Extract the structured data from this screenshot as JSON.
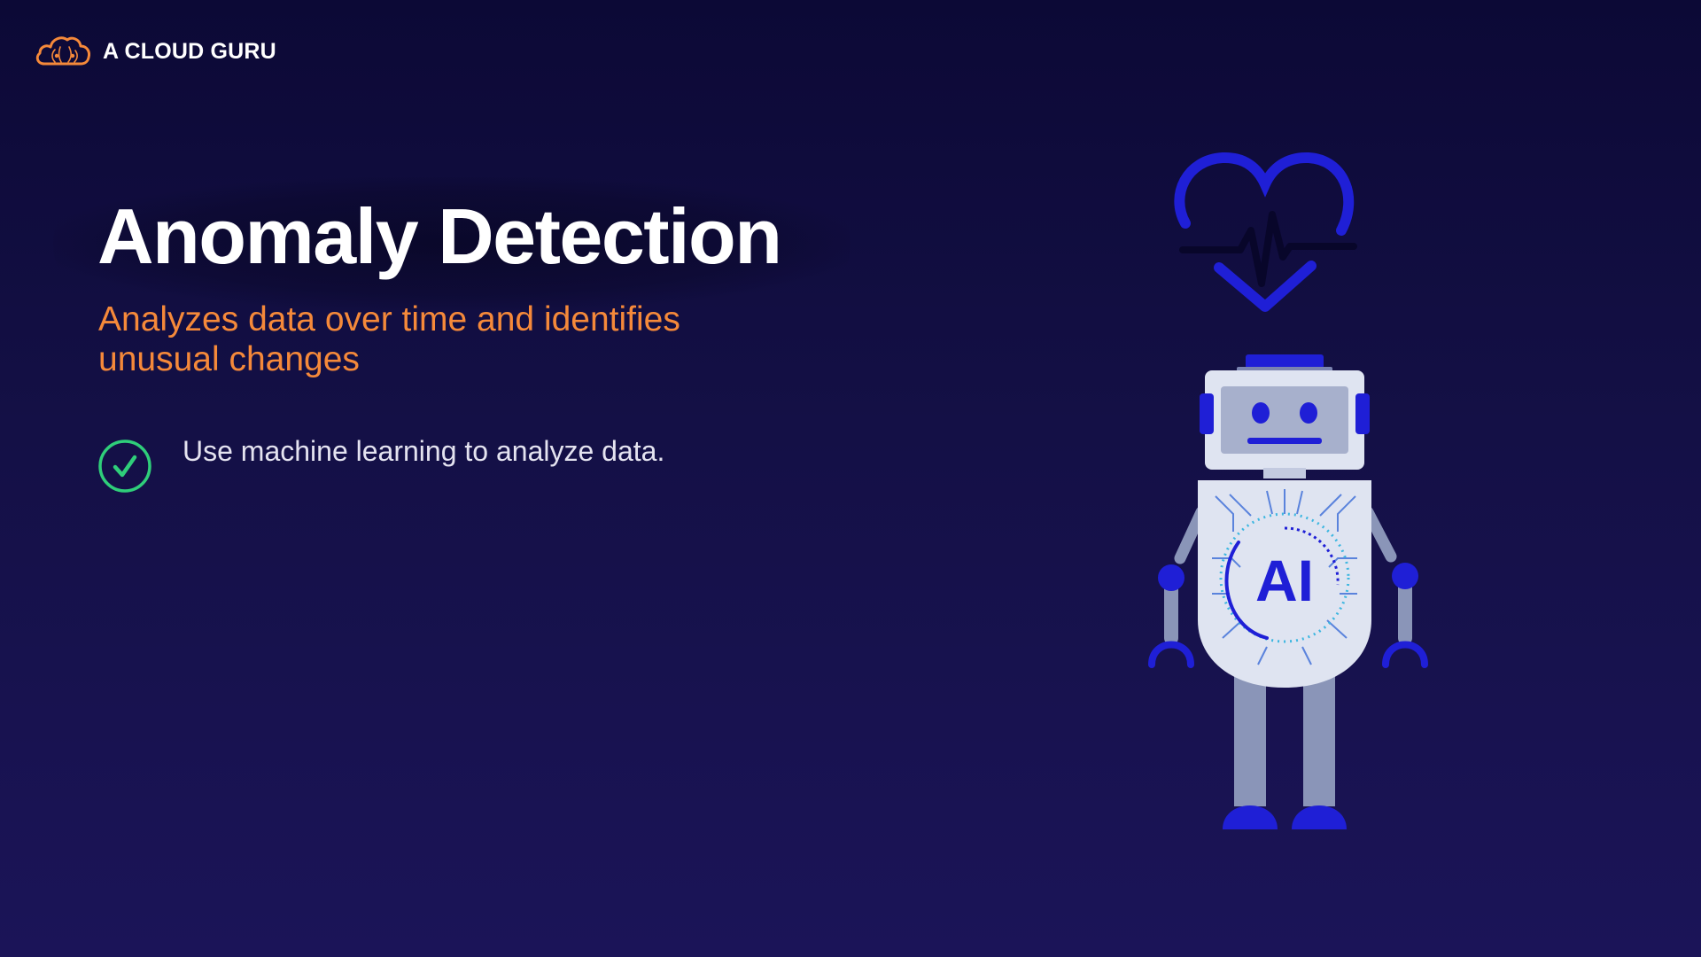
{
  "brand": {
    "name": "A CLOUD GURU",
    "icon": "cloud-logo-icon",
    "accent_color": "#f5893a"
  },
  "slide": {
    "title": "Anomaly Detection",
    "subtitle": "Analyzes data over time and identifies unusual changes",
    "bullets": [
      {
        "icon": "check-circle-icon",
        "text": "Use machine learning to analyze data."
      }
    ]
  },
  "illustration": {
    "robot_chest_label": "AI",
    "icons": [
      "heartbeat-icon",
      "robot-icon"
    ]
  },
  "colors": {
    "background_top": "#0c0936",
    "background_bottom": "#1b1458",
    "subtitle": "#f5893a",
    "check": "#2fce7a",
    "robot_accent": "#1a1ad0"
  }
}
